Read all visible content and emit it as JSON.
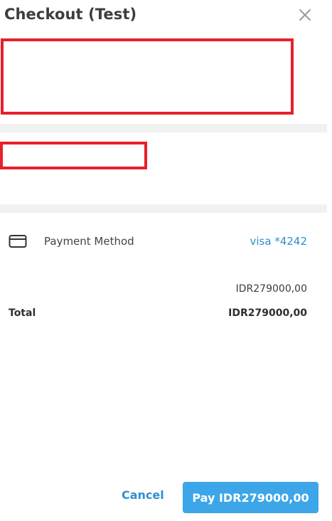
{
  "window": {
    "title": "Checkout (Test)"
  },
  "summary": {
    "line_amount": "IDR279000,00",
    "total_label": "Total",
    "total_amount": "IDR279000,00"
  },
  "payment": {
    "label": "Payment Method",
    "value": "visa *4242",
    "icon": "credit-card-icon"
  },
  "footer": {
    "cancel_label": "Cancel",
    "pay_label": "Pay IDR279000,00"
  },
  "colors": {
    "accent": "#3da6e8",
    "link": "#2d8fcd",
    "redaction": "#e8202a",
    "separator": "#f1f1f1"
  }
}
